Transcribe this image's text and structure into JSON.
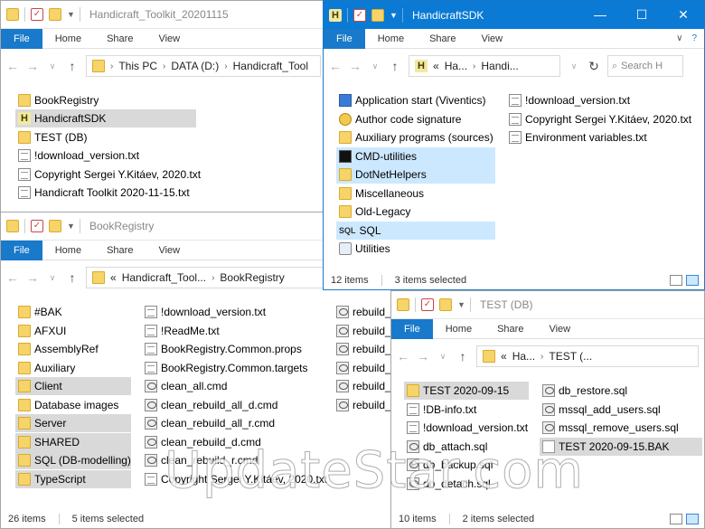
{
  "w1": {
    "title": "Handicraft_Toolkit_20201115",
    "ribbon": {
      "file": "File",
      "home": "Home",
      "share": "Share",
      "view": "View"
    },
    "address": [
      "This PC",
      "DATA (D:)",
      "Handicraft_Tool"
    ],
    "items": [
      "BookRegistry",
      "HandicraftSDK",
      "TEST (DB)",
      "!download_version.txt",
      "Copyright Sergei Y.Kitáev, 2020.txt",
      "Handicraft Toolkit 2020-11-15.txt"
    ]
  },
  "w2": {
    "title": "HandicraftSDK",
    "ribbon": {
      "file": "File",
      "home": "Home",
      "share": "Share",
      "view": "View"
    },
    "address": [
      "«",
      "Ha...",
      "Handi..."
    ],
    "search_placeholder": "Search H",
    "col1": [
      "Application start (Viventics)",
      "Author code signature",
      "Auxiliary programs (sources)",
      "CMD-utilities",
      "DotNetHelpers",
      "Miscellaneous",
      "Old-Legacy",
      "SQL",
      "Utilities"
    ],
    "col2": [
      "!download_version.txt",
      "Copyright Sergei Y.Kitáev, 2020.txt",
      "Environment variables.txt"
    ],
    "status": {
      "count": "12 items",
      "selected": "3 items selected"
    }
  },
  "w3": {
    "title": "BookRegistry",
    "ribbon": {
      "file": "File",
      "home": "Home",
      "share": "Share",
      "view": "View"
    },
    "address": [
      "«",
      "Handicraft_Tool...",
      "BookRegistry"
    ],
    "col1": [
      "#BAK",
      "AFXUI",
      "AssemblyRef",
      "Auxiliary",
      "Client",
      "Database images",
      "Server",
      "SHARED",
      "SQL (DB-modelling)",
      "TypeScript"
    ],
    "col2": [
      "!download_version.txt",
      "!ReadMe.txt",
      "BookRegistry.Common.props",
      "BookRegistry.Common.targets",
      "clean_all.cmd",
      "clean_rebuild_all_d.cmd",
      "clean_rebuild_all_r.cmd",
      "clean_rebuild_d.cmd",
      "clean_rebuild_r.cmd",
      "Copyright Sergei Y.Kitáev, 2020.txt"
    ],
    "col3": [
      "rebuild_",
      "rebuild_",
      "rebuild_",
      "rebuild_",
      "rebuild_",
      "rebuild_"
    ],
    "status": {
      "count": "26 items",
      "selected": "5 items selected"
    }
  },
  "w4": {
    "title": "TEST (DB)",
    "ribbon": {
      "file": "File",
      "home": "Home",
      "share": "Share",
      "view": "View"
    },
    "address": [
      "«",
      "Ha...",
      "TEST (..."
    ],
    "col1": [
      "TEST 2020-09-15",
      "!DB-info.txt",
      "!download_version.txt",
      "db_attach.sql",
      "db_backup.sql",
      "db_detach.sql"
    ],
    "col2": [
      "db_restore.sql",
      "mssql_add_users.sql",
      "mssql_remove_users.sql",
      "TEST 2020-09-15.BAK"
    ],
    "status": {
      "count": "10 items",
      "selected": "2 items selected"
    }
  },
  "watermark": "UpdateStar.com"
}
